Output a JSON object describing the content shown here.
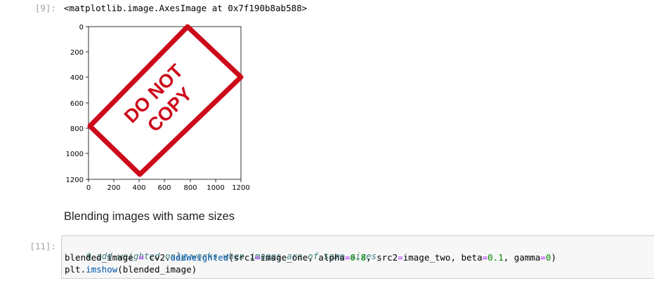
{
  "output_cell": {
    "prompt": "[9]:",
    "repr": "<matplotlib.image.AxesImage at 0x7f190b8ab588>"
  },
  "plot": {
    "y_ticks": [
      "0",
      "200",
      "400",
      "600",
      "800",
      "1000",
      "1200"
    ],
    "x_ticks": [
      "0",
      "200",
      "400",
      "600",
      "800",
      "1000",
      "1200"
    ],
    "stamp_text_line1": "DO NOT",
    "stamp_text_line2": "COPY",
    "stamp_color": "#cc0a1a"
  },
  "markdown": {
    "text": "Blending images with same sizes"
  },
  "code_cell": {
    "prompt": "[11]:",
    "line1_comment": "# add weighted only works when images are of same sizes",
    "line2": {
      "var": "blended_image ",
      "eq": "=",
      "call_prefix": " cv2.",
      "func": "addWeighted",
      "args_open": "(src1",
      "eq1": "=",
      "arg1": "image_one, alpha",
      "eq2": "=",
      "num1": "0.8",
      "arg2": ", src2",
      "eq3": "=",
      "arg3": "image_two, beta",
      "eq4": "=",
      "num2": "0.1",
      "arg4": ", gamma",
      "eq5": "=",
      "num3": "0",
      "close": ")"
    },
    "line3": {
      "obj": "plt.",
      "func": "imshow",
      "args": "(blended_image)"
    }
  }
}
